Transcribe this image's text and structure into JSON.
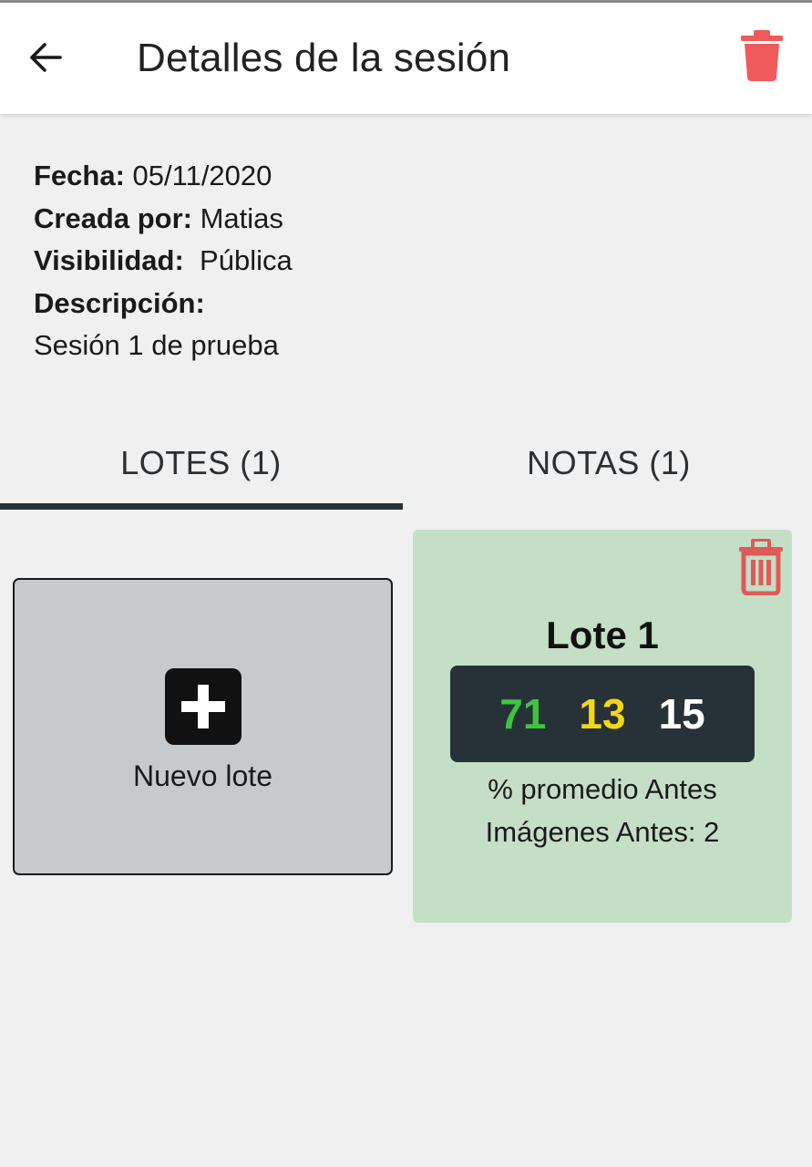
{
  "appbar": {
    "title": "Detalles de la sesión",
    "back_icon": "arrow-left-icon",
    "delete_icon": "trash-icon",
    "delete_icon_color": "#ef5b5b"
  },
  "session": {
    "fecha_label": "Fecha:",
    "fecha_value": "05/11/2020",
    "creada_label": "Creada por:",
    "creada_value": "Matias",
    "visibilidad_label": "Visibilidad:",
    "visibilidad_value": "Pública",
    "descripcion_label": "Descripción:",
    "descripcion_value": "Sesión 1 de prueba"
  },
  "tabs": [
    {
      "label": "LOTES (1)",
      "selected": true
    },
    {
      "label": "NOTAS (1)",
      "selected": false
    }
  ],
  "new_lote": {
    "label": "Nuevo lote",
    "icon": "plus-square-icon"
  },
  "lotes": [
    {
      "title": "Lote 1",
      "stats": [
        "71",
        "13",
        "15"
      ],
      "stat_colors": [
        "#3dc63d",
        "#f5d616",
        "#ffffff"
      ],
      "caption": "% promedio Antes",
      "images_line": "Imágenes Antes: 2",
      "delete_icon": "trash-outline-icon",
      "delete_icon_color": "#e05a5a",
      "card_color": "#c5dfc6"
    }
  ],
  "colors": {
    "tab_indicator": "#263238",
    "stats_background": "#263238",
    "page_background": "#f0f0f0"
  }
}
